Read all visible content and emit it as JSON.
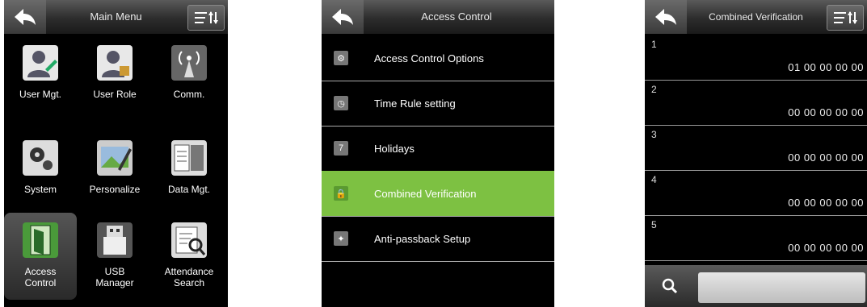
{
  "main_menu": {
    "title": "Main Menu",
    "back_icon": "back-arrow-icon",
    "menu_icon": "sort-menu-icon",
    "items": [
      {
        "label": "User Mgt.",
        "icon": "user-edit-icon"
      },
      {
        "label": "User Role",
        "icon": "user-lock-icon"
      },
      {
        "label": "Comm.",
        "icon": "antenna-icon"
      },
      {
        "label": "System",
        "icon": "gears-icon"
      },
      {
        "label": "Personalize",
        "icon": "picture-edit-icon"
      },
      {
        "label": "Data Mgt.",
        "icon": "server-icon"
      },
      {
        "label": "Access\nControl",
        "icon": "door-icon",
        "selected": true
      },
      {
        "label": "USB\nManager",
        "icon": "usb-drive-icon"
      },
      {
        "label": "Attendance\nSearch",
        "icon": "report-search-icon"
      }
    ]
  },
  "access_control": {
    "title": "Access Control",
    "items": [
      {
        "label": "Access Control Options",
        "icon": "settings-doc-icon"
      },
      {
        "label": "Time Rule setting",
        "icon": "clock-icon"
      },
      {
        "label": "Holidays",
        "icon": "calendar-icon"
      },
      {
        "label": "Combined Verification",
        "icon": "locks-icon",
        "selected": true
      },
      {
        "label": "Anti-passback Setup",
        "icon": "person-arrows-icon"
      }
    ]
  },
  "combined_verification": {
    "title": "Combined Verification",
    "rows": [
      {
        "index": "1",
        "value": "01 00 00 00 00"
      },
      {
        "index": "2",
        "value": "00 00 00 00 00"
      },
      {
        "index": "3",
        "value": "00 00 00 00 00"
      },
      {
        "index": "4",
        "value": "00 00 00 00 00"
      },
      {
        "index": "5",
        "value": "00 00 00 00 00"
      }
    ],
    "search_placeholder": ""
  },
  "colors": {
    "selected_row": "#7dc142",
    "background": "#000000"
  }
}
